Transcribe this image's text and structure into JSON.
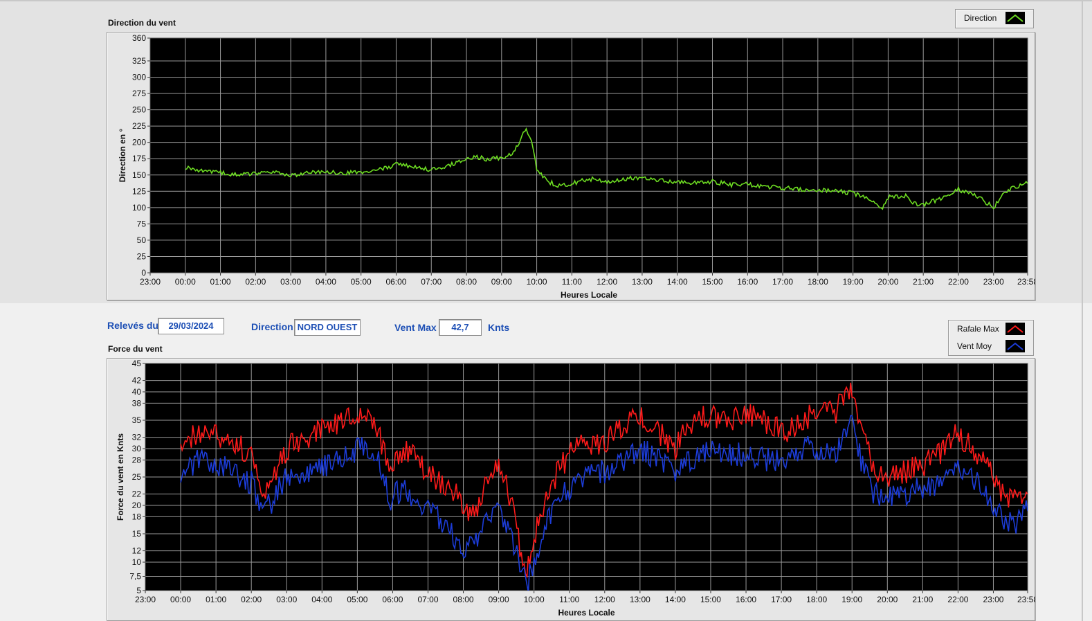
{
  "header": {
    "date_label": "Relevés du",
    "date_value": "29/03/2024",
    "direction_label": "Direction",
    "direction_value": "NORD OUEST",
    "ventmax_label": "Vent Max",
    "ventmax_value": "42,7",
    "ventmax_unit": "Knts"
  },
  "legend_top": {
    "items": [
      {
        "label": "Direction",
        "color": "#6ddc22"
      }
    ]
  },
  "legend_bottom": {
    "items": [
      {
        "label": "Rafale Max",
        "color": "#ff1a1a"
      },
      {
        "label": "Vent Moy",
        "color": "#1c3cd8"
      }
    ]
  },
  "chart_data": [
    {
      "type": "line",
      "title": "Direction du vent",
      "xlabel": "Heures Locale",
      "ylabel": "Direction en °",
      "ylim": [
        0,
        360
      ],
      "xlim": [
        "23:00",
        "23:58"
      ],
      "grid": true,
      "y_ticks": [
        "0",
        "25",
        "50",
        "75",
        "100",
        "125",
        "150",
        "175",
        "200",
        "225",
        "250",
        "275",
        "300",
        "325",
        "360"
      ],
      "y_tick_values": [
        0,
        25,
        50,
        75,
        100,
        125,
        150,
        175,
        200,
        225,
        250,
        275,
        300,
        325,
        360
      ],
      "x_ticks": [
        "23:00",
        "00:00",
        "01:00",
        "02:00",
        "03:00",
        "04:00",
        "05:00",
        "06:00",
        "07:00",
        "08:00",
        "09:00",
        "10:00",
        "11:00",
        "12:00",
        "13:00",
        "14:00",
        "15:00",
        "16:00",
        "17:00",
        "18:00",
        "19:00",
        "20:00",
        "21:00",
        "22:00",
        "23:00",
        "23:58"
      ],
      "x_tick_values": [
        -1,
        0,
        1,
        2,
        3,
        4,
        5,
        6,
        7,
        8,
        9,
        10,
        11,
        12,
        13,
        14,
        15,
        16,
        17,
        18,
        19,
        20,
        21,
        22,
        23,
        23.97
      ],
      "series": [
        {
          "name": "Direction",
          "color": "#6ddc22",
          "x": [
            0,
            0.5,
            1,
            1.5,
            2,
            2.5,
            3,
            3.5,
            4,
            4.5,
            5,
            5.5,
            6,
            6.5,
            7,
            7.5,
            8,
            8.3,
            8.6,
            9,
            9.3,
            9.5,
            9.7,
            9.85,
            10,
            10.3,
            10.6,
            11,
            11.5,
            12,
            12.5,
            13,
            13.5,
            14,
            14.5,
            15,
            15.5,
            16,
            16.5,
            17,
            17.5,
            18,
            18.5,
            19,
            19.5,
            19.8,
            20,
            20.5,
            20.7,
            21,
            21.5,
            22,
            22.5,
            23,
            23.3,
            23.5,
            23.97
          ],
          "y": [
            162,
            157,
            153,
            150,
            152,
            154,
            148,
            153,
            156,
            152,
            155,
            158,
            166,
            163,
            158,
            165,
            176,
            178,
            174,
            177,
            181,
            200,
            222,
            200,
            160,
            140,
            134,
            137,
            144,
            140,
            144,
            146,
            142,
            139,
            138,
            140,
            135,
            136,
            132,
            130,
            128,
            128,
            126,
            122,
            112,
            97,
            116,
            118,
            106,
            104,
            114,
            128,
            118,
            100,
            122,
            130,
            137
          ]
        }
      ]
    },
    {
      "type": "line",
      "title": "Force du vent",
      "xlabel": "Heures Locale",
      "ylabel": "Force du vent en Knts",
      "ylim": [
        5,
        45
      ],
      "xlim": [
        "23:00",
        "23:58"
      ],
      "grid": true,
      "y_ticks": [
        "5",
        "7,5",
        "10",
        "12",
        "15",
        "18",
        "20",
        "22",
        "25",
        "28",
        "30",
        "32",
        "35",
        "38",
        "40",
        "42",
        "45"
      ],
      "y_tick_values": [
        5,
        7.5,
        10,
        12,
        15,
        18,
        20,
        22,
        25,
        28,
        30,
        32,
        35,
        38,
        40,
        42,
        45
      ],
      "x_ticks": [
        "23:00",
        "00:00",
        "01:00",
        "02:00",
        "03:00",
        "04:00",
        "05:00",
        "06:00",
        "07:00",
        "08:00",
        "09:00",
        "10:00",
        "11:00",
        "12:00",
        "13:00",
        "14:00",
        "15:00",
        "16:00",
        "17:00",
        "18:00",
        "19:00",
        "20:00",
        "21:00",
        "22:00",
        "23:00",
        "23:58"
      ],
      "x_tick_values": [
        -1,
        0,
        1,
        2,
        3,
        4,
        5,
        6,
        7,
        8,
        9,
        10,
        11,
        12,
        13,
        14,
        15,
        16,
        17,
        18,
        19,
        20,
        21,
        22,
        23,
        23.97
      ],
      "series": [
        {
          "name": "Rafale Max",
          "color": "#ff1a1a",
          "x": [
            0,
            0.3,
            0.6,
            1,
            1.5,
            2,
            2.4,
            2.7,
            3,
            3.5,
            4,
            4.5,
            5,
            5.3,
            5.6,
            5.9,
            6.3,
            6.7,
            7,
            7.4,
            7.8,
            8.1,
            8.4,
            8.7,
            9,
            9.3,
            9.6,
            9.8,
            10,
            10.3,
            10.6,
            11,
            11.5,
            12,
            12.5,
            13,
            13.5,
            14,
            14.5,
            15,
            15.5,
            16,
            16.5,
            17,
            17.5,
            18,
            18.5,
            18.8,
            19,
            19.3,
            19.6,
            20,
            20.5,
            21,
            21.5,
            22,
            22.5,
            23,
            23.3,
            23.6,
            23.97
          ],
          "y": [
            31,
            32,
            33,
            32,
            31,
            29,
            22,
            26,
            30,
            32,
            33,
            35,
            36,
            37,
            33,
            26,
            30,
            28,
            26,
            24,
            22,
            19,
            20,
            25,
            27,
            22,
            13,
            9,
            14,
            21,
            25,
            29,
            31,
            31,
            34,
            36,
            33,
            30,
            35,
            36,
            35,
            36,
            35,
            33,
            34,
            37,
            36,
            40,
            41,
            33,
            27,
            25,
            26,
            27,
            29,
            33,
            29,
            25,
            22,
            21,
            22
          ]
        },
        {
          "name": "Vent Moy",
          "color": "#1c3cd8",
          "x": [
            0,
            0.3,
            0.6,
            1,
            1.5,
            2,
            2.4,
            2.7,
            3,
            3.5,
            4,
            4.5,
            5,
            5.3,
            5.6,
            5.9,
            6.3,
            6.7,
            7,
            7.4,
            7.8,
            8.1,
            8.4,
            8.7,
            9,
            9.3,
            9.6,
            9.8,
            10,
            10.3,
            10.6,
            11,
            11.5,
            12,
            12.5,
            13,
            13.5,
            14,
            14.5,
            15,
            15.5,
            16,
            16.5,
            17,
            17.5,
            18,
            18.5,
            18.8,
            19,
            19.3,
            19.6,
            20,
            20.5,
            21,
            21.5,
            22,
            22.5,
            23,
            23.3,
            23.6,
            23.97
          ],
          "y": [
            25,
            27,
            28,
            27,
            26,
            24,
            19,
            22,
            25,
            26,
            27,
            28,
            30,
            30,
            28,
            21,
            23,
            21,
            20,
            17,
            14,
            12,
            14,
            18,
            20,
            16,
            9,
            6,
            10,
            16,
            20,
            23,
            25,
            26,
            28,
            30,
            28,
            26,
            28,
            30,
            29,
            29,
            28,
            28,
            30,
            30,
            29,
            33,
            34,
            27,
            22,
            21,
            22,
            23,
            24,
            27,
            24,
            20,
            18,
            17,
            19
          ]
        }
      ]
    }
  ]
}
